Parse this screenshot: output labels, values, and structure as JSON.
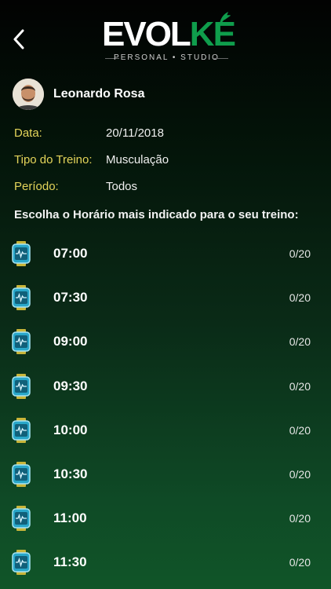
{
  "header": {
    "logo_text_white": "EVOL",
    "logo_text_accent": "KÉ",
    "logo_subtitle": "PERSONAL • STUDIO",
    "accent_color": "#0f9d4c"
  },
  "profile": {
    "name": "Leonardo Rosa"
  },
  "info": {
    "date_label": "Data:",
    "date_value": "20/11/2018",
    "type_label": "Tipo do Treino:",
    "type_value": "Musculação",
    "period_label": "Período:",
    "period_value": "Todos"
  },
  "prompt": "Escolha o Horário mais indicado para o seu treino:",
  "slots": [
    {
      "time": "07:00",
      "count": "0/20"
    },
    {
      "time": "07:30",
      "count": "0/20"
    },
    {
      "time": "09:00",
      "count": "0/20"
    },
    {
      "time": "09:30",
      "count": "0/20"
    },
    {
      "time": "10:00",
      "count": "0/20"
    },
    {
      "time": "10:30",
      "count": "0/20"
    },
    {
      "time": "11:00",
      "count": "0/20"
    },
    {
      "time": "11:30",
      "count": "0/20"
    }
  ],
  "icons": {
    "back": "chevron-left-icon",
    "slot": "smartwatch-icon",
    "label_color": "#e4d45a"
  }
}
